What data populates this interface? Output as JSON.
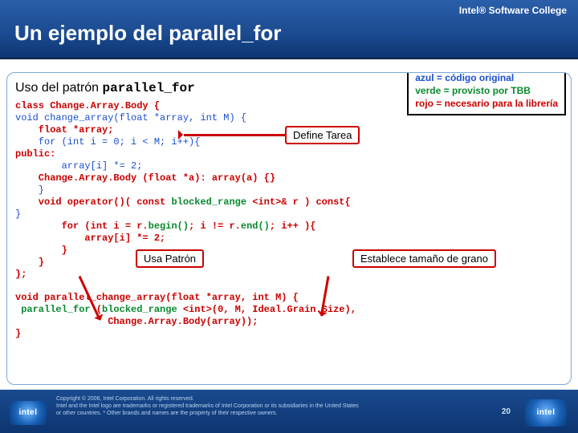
{
  "brand": "Intel® Software College",
  "title": "Un ejemplo del parallel_for",
  "subtitle_prefix": "Uso del patrón ",
  "subtitle_code": "parallel_for",
  "legend": {
    "blue": "azul = código original",
    "green": "verde = provisto por TBB",
    "red": "rojo = necesario para la librería"
  },
  "callouts": {
    "define": "Define Tarea",
    "usa": "Usa Patrón",
    "grano": "Establece tamaño de grano"
  },
  "code": {
    "l01a": "class Change.Array.Body {",
    "l01b": "void change_array(float *array, int M) {",
    "l02a": "    float *array;",
    "l02b": "    for (int i = 0; i < M; i++){",
    "l03": "public:",
    "l03b": "        array[i] *= 2;",
    "l04": "    Change.Array.Body (float *a): array(a) {}",
    "l04b": "    }",
    "l05": "    void operator()( const ",
    "l05g": "blocked_range",
    "l05c": " <int>& r ) const{",
    "l06": "}",
    "l07": "        for (int i = r.",
    "l07g1": "begin()",
    "l07m": "; i != r.",
    "l07g2": "end()",
    "l07e": "; i++ ){",
    "l08": "            array[i] *= 2;",
    "l09": "        }",
    "l10": "    }",
    "l11": "};",
    "b1a": "void ",
    "b1r": "parallel_change_array",
    "b1b": "(float *array, int M) {",
    "b2g1": " parallel_for",
    "b2a": " (",
    "b2g2": "blocked_range",
    "b2b": " <int>(0, M, ",
    "b2r": "Ideal.Grain.Size",
    "b2c": "),",
    "b3": "                Change.Array.Body(array));",
    "b4": "}"
  },
  "footer": {
    "l1": "Copyright © 2006, Intel Corporation. All rights reserved.",
    "l2": "Intel and the Intel logo are trademarks or registered trademarks of Intel Corporation or its subsidiaries in the United States",
    "l3": "or other countries. * Other brands and names are the property of their respective owners."
  },
  "page": "20",
  "logo": "intel"
}
